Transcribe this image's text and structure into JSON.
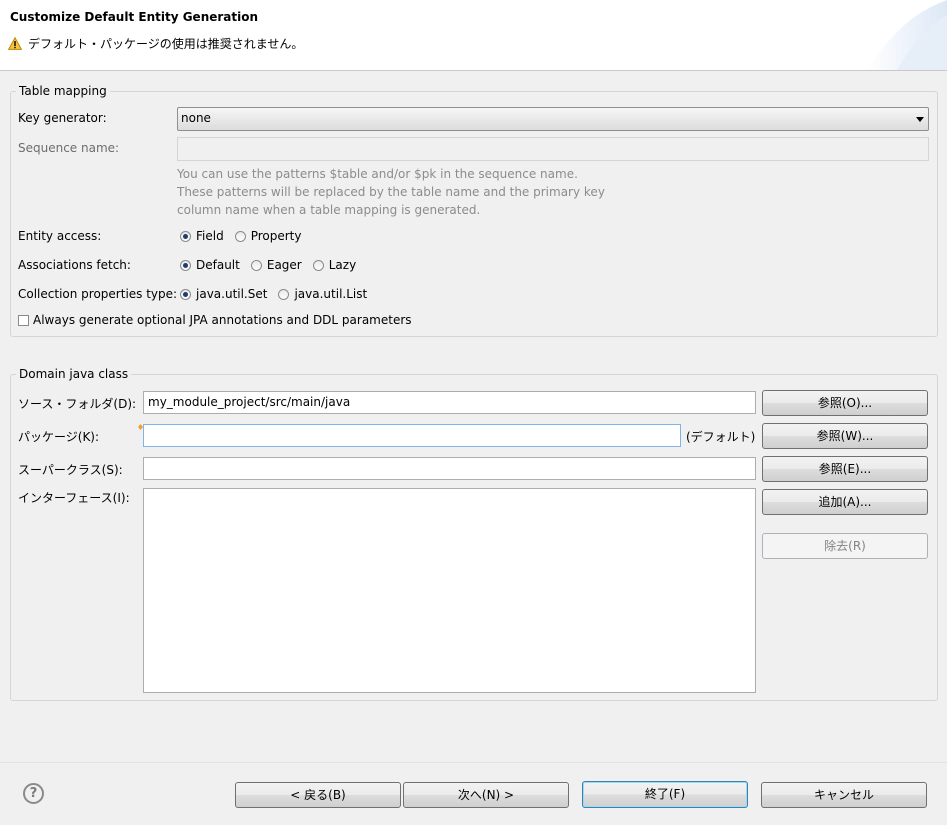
{
  "header": {
    "title": "Customize Default Entity Generation",
    "message": "デフォルト・パッケージの使用は推奨されません。",
    "message_icon": "warning-icon"
  },
  "table_mapping": {
    "group_label": "Table mapping",
    "key_generator_label": "Key generator:",
    "key_generator_value": "none",
    "sequence_name_label": "Sequence name:",
    "sequence_name_value": "",
    "hint_line1": "You can use the patterns $table and/or $pk in the sequence name.",
    "hint_line2": "These patterns will be replaced by the table name and the primary key",
    "hint_line3": "column name when a table mapping is generated.",
    "entity_access_label": "Entity access:",
    "entity_access_options": [
      "Field",
      "Property"
    ],
    "entity_access_selected": "Field",
    "associations_fetch_label": "Associations fetch:",
    "associations_fetch_options": [
      "Default",
      "Eager",
      "Lazy"
    ],
    "associations_fetch_selected": "Default",
    "collection_type_label": "Collection properties type:",
    "collection_type_options": [
      "java.util.Set",
      "java.util.List"
    ],
    "collection_type_selected": "java.util.Set",
    "always_generate_label": "Always generate optional JPA annotations and DDL parameters",
    "always_generate_checked": false
  },
  "domain_class": {
    "group_label": "Domain java class",
    "source_folder_label": "ソース・フォルダ(D):",
    "source_folder_value": "my_module_project/src/main/java",
    "browse_source_label": "参照(O)...",
    "package_label": "パッケージ(K):",
    "package_value": "",
    "package_default_label": "(デフォルト)",
    "browse_package_label": "参照(W)...",
    "superclass_label": "スーパークラス(S):",
    "superclass_value": "",
    "browse_superclass_label": "参照(E)...",
    "interfaces_label": "インターフェース(I):",
    "add_interface_label": "追加(A)...",
    "remove_interface_label": "除去(R)"
  },
  "footer": {
    "help_icon": "help-icon",
    "help_glyph": "?",
    "back_label": "< 戻る(B)",
    "next_label": "次へ(N) >",
    "finish_label": "終了(F)",
    "cancel_label": "キャンセル"
  }
}
